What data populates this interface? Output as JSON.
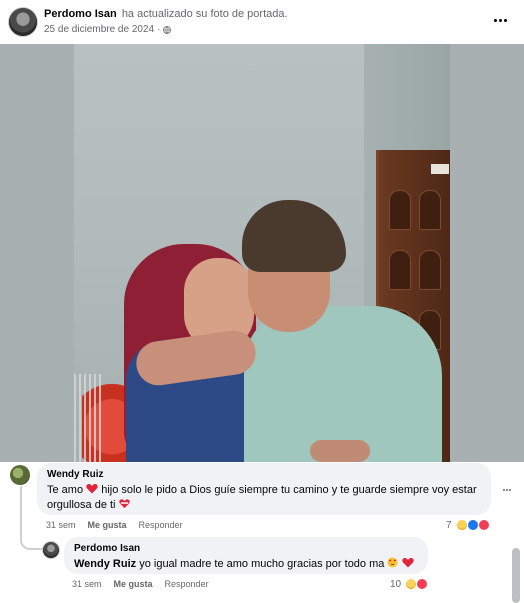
{
  "post": {
    "author": "Perdomo Isan",
    "action": "ha actualizado su foto de portada.",
    "date": "25 de diciembre de 2024",
    "separator": "·",
    "privacy_icon": "globe-icon",
    "more_icon": "more-horizontal-icon"
  },
  "photo": {
    "alt_icon": "cover-photo"
  },
  "comments": [
    {
      "author": "Wendy Ruiz",
      "text_before": "Te amo",
      "text_middle": "hijo solo le pido a Dios guíe siempre tu camino y te guarde siempre voy estar orgullosa de ti",
      "time": "31 sem",
      "like_label": "Me gusta",
      "reply_label": "Responder",
      "reaction_count": "7",
      "reactions": [
        "care-icon",
        "like-icon",
        "love-icon"
      ]
    },
    {
      "author": "Perdomo Isan",
      "mention": "Wendy Ruiz",
      "text": "yo igual madre te amo mucho gracias por todo ma",
      "time": "31 sem",
      "like_label": "Me gusta",
      "reply_label": "Responder",
      "reaction_count": "10",
      "reactions": [
        "care-icon",
        "love-icon"
      ]
    }
  ],
  "colors": {
    "bubble": "#f0f2f5",
    "secondary_text": "#65676b",
    "like_blue": "#1877f2",
    "love_red": "#f33e58"
  }
}
